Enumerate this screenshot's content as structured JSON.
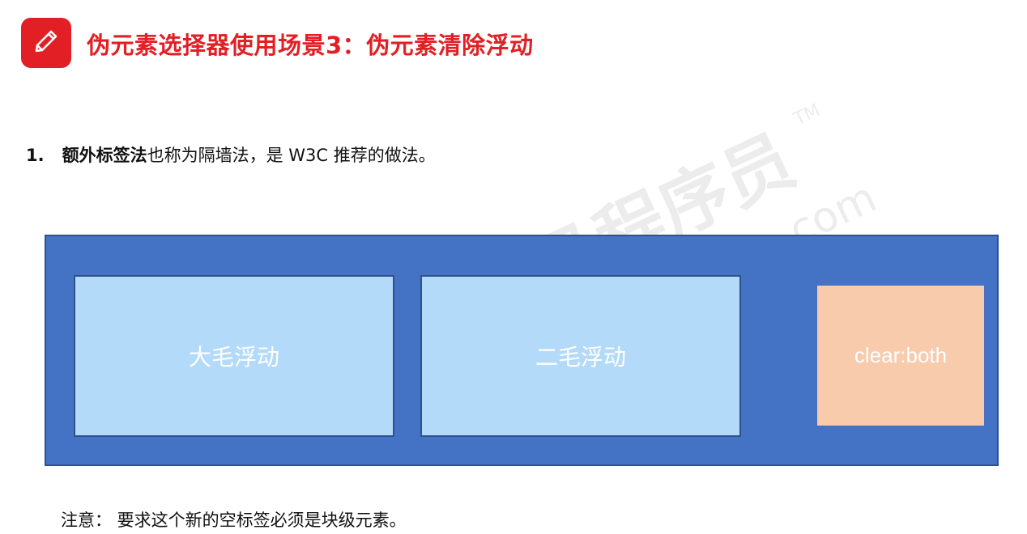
{
  "header": {
    "icon": "pencil-icon",
    "title": "伪元素选择器使用场景3：伪元素清除浮动"
  },
  "item": {
    "number": "1.",
    "strong_text": "额外标签法",
    "rest_text": "也称为隔墙法，是 W3C 推荐的做法。"
  },
  "diagram": {
    "box1_label": "大毛浮动",
    "box2_label": "二毛浮动",
    "clear_label": "clear:both"
  },
  "note": {
    "text": "注意： 要求这个新的空标签必须是块级元素。"
  },
  "watermark": {
    "brand": "黑马程序员",
    "tm": "TM",
    "url": "www.itheima.com"
  },
  "colors": {
    "accent_red": "#e21f24",
    "container_blue": "#4472c4",
    "float_box_light_blue": "#b4daf9",
    "clear_box_peach": "#f7cbac"
  }
}
